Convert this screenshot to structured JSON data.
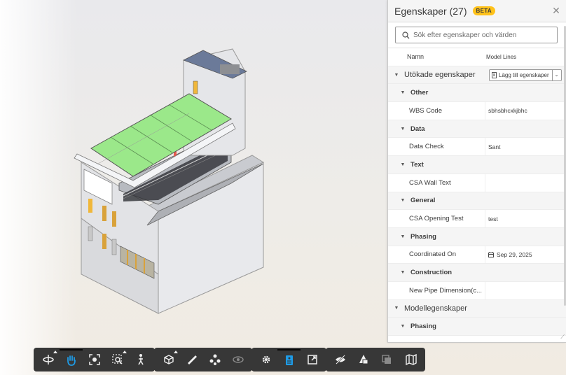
{
  "panel": {
    "title": "Egenskaper (27)",
    "beta": "BETA",
    "search_placeholder": "Sök efter egenskaper och värden",
    "column_name": "Namn",
    "column_value": "Model Lines",
    "add_properties_label": "Lägg till egenskaper",
    "rows": [
      {
        "kind": "section",
        "label": "Utökade egenskaper"
      },
      {
        "kind": "group",
        "label": "Other"
      },
      {
        "kind": "prop",
        "name": "WBS Code",
        "value": "sbhsbhcxkjbhc"
      },
      {
        "kind": "group",
        "label": "Data"
      },
      {
        "kind": "prop",
        "name": "Data Check",
        "value": "Sant"
      },
      {
        "kind": "group",
        "label": "Text"
      },
      {
        "kind": "prop",
        "name": "CSA Wall Text",
        "value": ""
      },
      {
        "kind": "group",
        "label": "General"
      },
      {
        "kind": "prop",
        "name": "CSA Opening Test",
        "value": "test"
      },
      {
        "kind": "group",
        "label": "Phasing"
      },
      {
        "kind": "prop",
        "name": "Coordinated On",
        "value": "Sep 29, 2025",
        "icon": "calendar-icon"
      },
      {
        "kind": "group",
        "label": "Construction"
      },
      {
        "kind": "prop",
        "name": "New Pipe Dimension(c...",
        "value": ""
      },
      {
        "kind": "section",
        "label": "Modellegenskaper"
      },
      {
        "kind": "group",
        "label": "Phasing"
      }
    ]
  },
  "toolbar": {
    "groups": [
      {
        "buttons": [
          {
            "icon": "orbit-icon",
            "more": true
          },
          {
            "icon": "pan-hand-icon",
            "active": true
          },
          {
            "icon": "fit-view-icon"
          },
          {
            "icon": "zoom-window-icon",
            "more": true
          },
          {
            "icon": "first-person-icon"
          }
        ]
      },
      {
        "buttons": [
          {
            "icon": "section-box-icon",
            "more": true
          },
          {
            "icon": "measure-icon"
          },
          {
            "icon": "explode-icon"
          },
          {
            "icon": "hide-eye-icon",
            "disabled": true
          }
        ]
      },
      {
        "buttons": [
          {
            "icon": "settings-gear-icon"
          },
          {
            "icon": "properties-icon",
            "active": true
          },
          {
            "icon": "fullscreen-icon"
          }
        ]
      },
      {
        "buttons": [
          {
            "icon": "visibility-off-icon"
          },
          {
            "icon": "model-browser-icon"
          },
          {
            "icon": "layers-icon",
            "disabled": true
          }
        ]
      },
      {
        "buttons": [
          {
            "icon": "sheets-map-icon"
          }
        ]
      }
    ]
  },
  "colors": {
    "accent": "#ffc21a",
    "toolbar_bg": "#373737",
    "active_icon": "#1e9be6",
    "roof_green": "#8fe07a"
  }
}
